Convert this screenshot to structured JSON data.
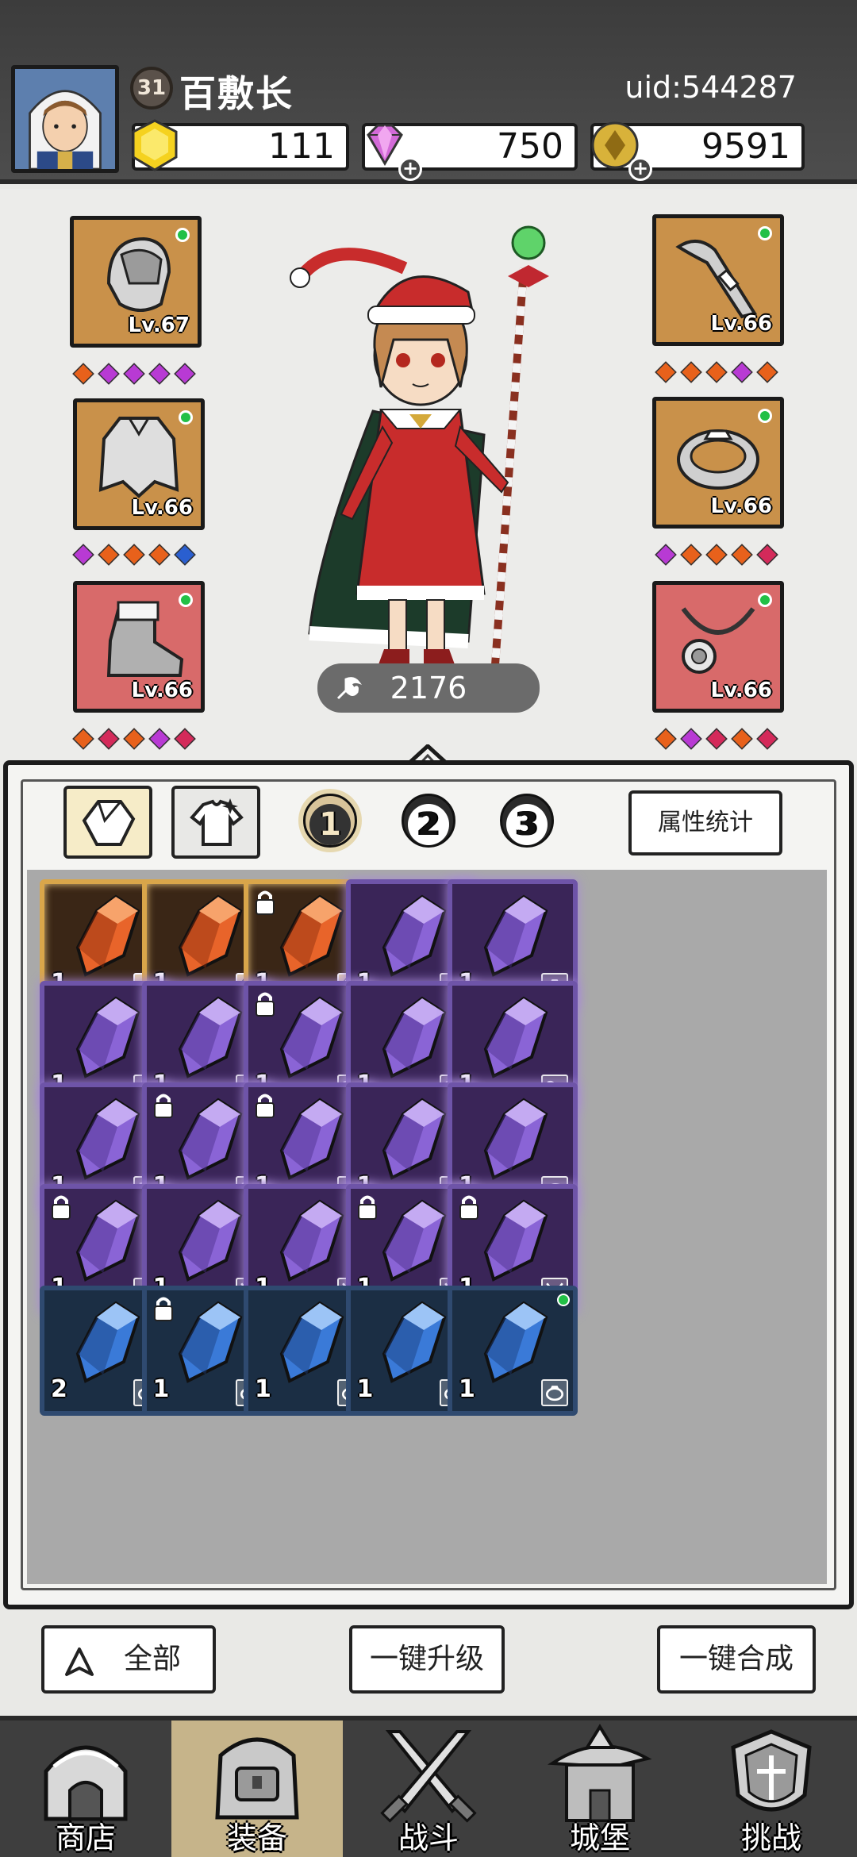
{
  "player": {
    "level": "31",
    "name": "百敷长",
    "uid": "uid:544287"
  },
  "resources": {
    "gold": "111",
    "diamond": "750",
    "coin": "9591"
  },
  "equipment": {
    "left": [
      {
        "name": "helmet",
        "level": "Lv.67",
        "frame": "orange",
        "gems": [
          "#e8611b",
          "#b83ad4",
          "#b83ad4",
          "#b83ad4",
          "#b83ad4"
        ]
      },
      {
        "name": "armor",
        "level": "Lv.66",
        "frame": "orange",
        "gems": [
          "#b83ad4",
          "#e8611b",
          "#e8611b",
          "#e8611b",
          "#2a5fd0"
        ]
      },
      {
        "name": "boots",
        "level": "Lv.66",
        "frame": "red",
        "gems": [
          "#e8611b",
          "#d42a5a",
          "#e8611b",
          "#b83ad4",
          "#d42a5a"
        ]
      }
    ],
    "right": [
      {
        "name": "weapon",
        "level": "Lv.66",
        "frame": "orange",
        "gems": [
          "#e8611b",
          "#e8611b",
          "#e8611b",
          "#b83ad4",
          "#e8611b"
        ]
      },
      {
        "name": "ring",
        "level": "Lv.66",
        "frame": "orange",
        "gems": [
          "#b83ad4",
          "#e8611b",
          "#e8611b",
          "#e8611b",
          "#d42a5a"
        ]
      },
      {
        "name": "necklace",
        "level": "Lv.66",
        "frame": "red",
        "gems": [
          "#e8611b",
          "#b83ad4",
          "#d42a5a",
          "#e8611b",
          "#d42a5a"
        ]
      }
    ]
  },
  "power": "2176",
  "tabs": {
    "pages": [
      "1",
      "2",
      "3"
    ],
    "active_page": "1",
    "stats_label": "属性统计"
  },
  "inventory": [
    [
      {
        "r": "orange",
        "q": "1",
        "t": "ring",
        "l": false
      },
      {
        "r": "orange",
        "q": "1",
        "t": "armor",
        "l": false
      },
      {
        "r": "orange",
        "q": "1",
        "t": "armor",
        "l": true
      },
      {
        "r": "purple",
        "q": "1",
        "t": "ring",
        "l": false
      },
      {
        "r": "purple",
        "q": "1",
        "t": "ring",
        "l": false
      }
    ],
    [
      {
        "r": "purple",
        "q": "1",
        "t": "boots",
        "l": false
      },
      {
        "r": "purple",
        "q": "1",
        "t": "boots",
        "l": false
      },
      {
        "r": "purple",
        "q": "1",
        "t": "weapon",
        "l": true
      },
      {
        "r": "purple",
        "q": "1",
        "t": "weapon",
        "l": false
      },
      {
        "r": "purple",
        "q": "1",
        "t": "weapon",
        "l": false
      }
    ],
    [
      {
        "r": "purple",
        "q": "1",
        "t": "weapon",
        "l": false
      },
      {
        "r": "purple",
        "q": "1",
        "t": "weapon",
        "l": true
      },
      {
        "r": "purple",
        "q": "1",
        "t": "helmet",
        "l": true
      },
      {
        "r": "purple",
        "q": "1",
        "t": "helmet",
        "l": false
      },
      {
        "r": "purple",
        "q": "1",
        "t": "helmet",
        "l": false
      }
    ],
    [
      {
        "r": "purple",
        "q": "1",
        "t": "helmet",
        "l": true
      },
      {
        "r": "purple",
        "q": "1",
        "t": "necklace",
        "l": false
      },
      {
        "r": "purple",
        "q": "1",
        "t": "necklace",
        "l": false
      },
      {
        "r": "purple",
        "q": "1",
        "t": "necklace",
        "l": true
      },
      {
        "r": "purple",
        "q": "1",
        "t": "necklace",
        "l": true
      }
    ],
    [
      {
        "r": "blue",
        "q": "2",
        "t": "ring",
        "l": false
      },
      {
        "r": "blue",
        "q": "1",
        "t": "ring",
        "l": true
      },
      {
        "r": "blue",
        "q": "1",
        "t": "ring",
        "l": false
      },
      {
        "r": "blue",
        "q": "1",
        "t": "ring",
        "l": false
      },
      {
        "r": "blue",
        "q": "1",
        "t": "ring",
        "l": false,
        "dot": true
      }
    ]
  ],
  "actions": {
    "filter": "全部",
    "upgrade_all": "一键升级",
    "merge_all": "一键合成"
  },
  "nav": [
    {
      "label": "商店",
      "icon": "shop-icon",
      "active": false
    },
    {
      "label": "装备",
      "icon": "backpack-icon",
      "active": true
    },
    {
      "label": "战斗",
      "icon": "swords-icon",
      "active": false
    },
    {
      "label": "城堡",
      "icon": "castle-icon",
      "active": false
    },
    {
      "label": "挑战",
      "icon": "shield-icon",
      "active": false
    }
  ],
  "colors": {
    "header": "#444444",
    "orange_frame": "#c9914a",
    "red_frame": "#d86a6a",
    "purple": "#6e54a8",
    "blue": "#2f4a70",
    "green_dot": "#22c046"
  }
}
